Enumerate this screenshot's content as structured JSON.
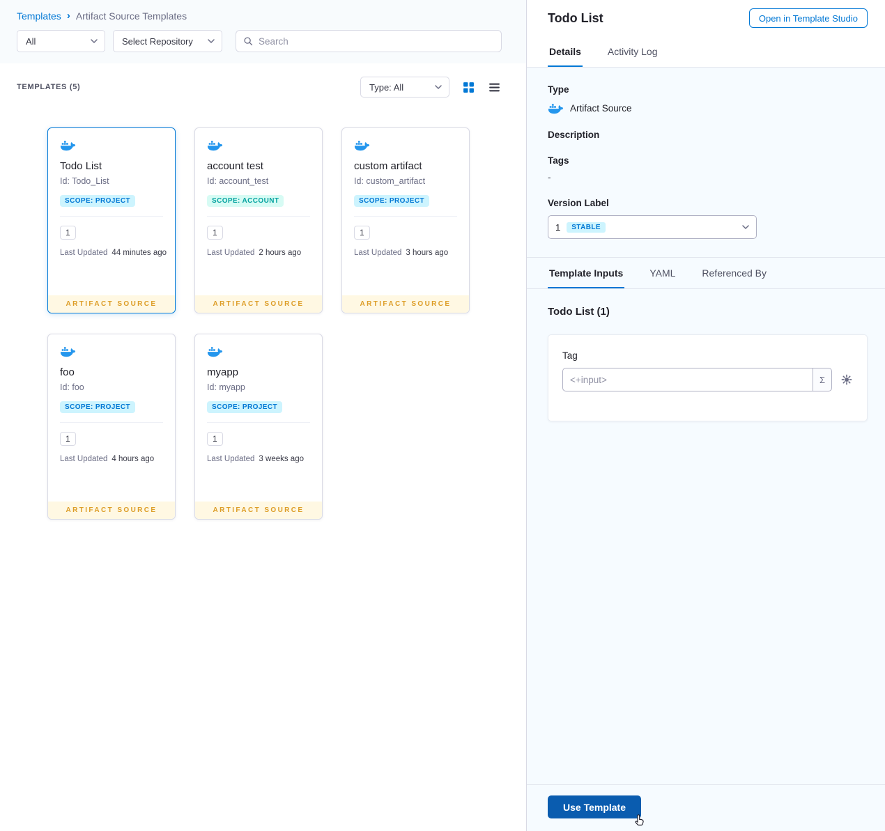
{
  "breadcrumb": {
    "root": "Templates",
    "separator": "›",
    "current": "Artifact Source Templates"
  },
  "filters": {
    "scope": "All",
    "repository": "Select Repository",
    "search_placeholder": "Search"
  },
  "list_header": {
    "count": "TEMPLATES (5)",
    "type_filter": "Type: All"
  },
  "card_common": {
    "last_updated_label": "Last Updated",
    "footer": "ARTIFACT SOURCE"
  },
  "cards": [
    {
      "name": "Todo List",
      "id": "Id: Todo_List",
      "scope_label": "SCOPE: PROJECT",
      "scope": "project",
      "version": "1",
      "updated": "44 minutes ago"
    },
    {
      "name": "account test",
      "id": "Id: account_test",
      "scope_label": "SCOPE: ACCOUNT",
      "scope": "account",
      "version": "1",
      "updated": "2 hours ago"
    },
    {
      "name": "custom artifact",
      "id": "Id: custom_artifact",
      "scope_label": "SCOPE: PROJECT",
      "scope": "project",
      "version": "1",
      "updated": "3 hours ago"
    },
    {
      "name": "foo",
      "id": "Id: foo",
      "scope_label": "SCOPE: PROJECT",
      "scope": "project",
      "version": "1",
      "updated": "4 hours ago"
    },
    {
      "name": "myapp",
      "id": "Id: myapp",
      "scope_label": "SCOPE: PROJECT",
      "scope": "project",
      "version": "1",
      "updated": "3 weeks ago"
    }
  ],
  "panel": {
    "title": "Todo List",
    "open_button": "Open in Template Studio",
    "tabs": {
      "details": "Details",
      "activity_log": "Activity Log"
    },
    "details": {
      "type_label": "Type",
      "type_value": "Artifact Source",
      "description_label": "Description",
      "tags_label": "Tags",
      "tags_value": "-",
      "version_label": "Version Label",
      "version_number": "1",
      "version_badge": "STABLE"
    },
    "input_tabs": {
      "template_inputs": "Template Inputs",
      "yaml": "YAML",
      "referenced_by": "Referenced By"
    },
    "inputs": {
      "section_title": "Todo List (1)",
      "tag_label": "Tag",
      "tag_placeholder": "<+input>",
      "expression_symbol": "Σ"
    },
    "footer": {
      "use_template": "Use Template"
    }
  },
  "colors": {
    "primary_blue": "#0278d5",
    "docker_blue": "#2496ed",
    "project_badge_bg": "#cdf4fe",
    "project_badge_text": "#0278d5",
    "account_badge_bg": "#d7fbf4",
    "account_badge_text": "#05a3a0",
    "artifact_footer_bg": "#fff8e3",
    "artifact_footer_text": "#dd9d27",
    "stable_badge_bg": "#cdf4fe",
    "stable_badge_text": "#0278d5",
    "use_template_button_bg": "#0a5caf",
    "panel_bg": "#f6fbff"
  }
}
